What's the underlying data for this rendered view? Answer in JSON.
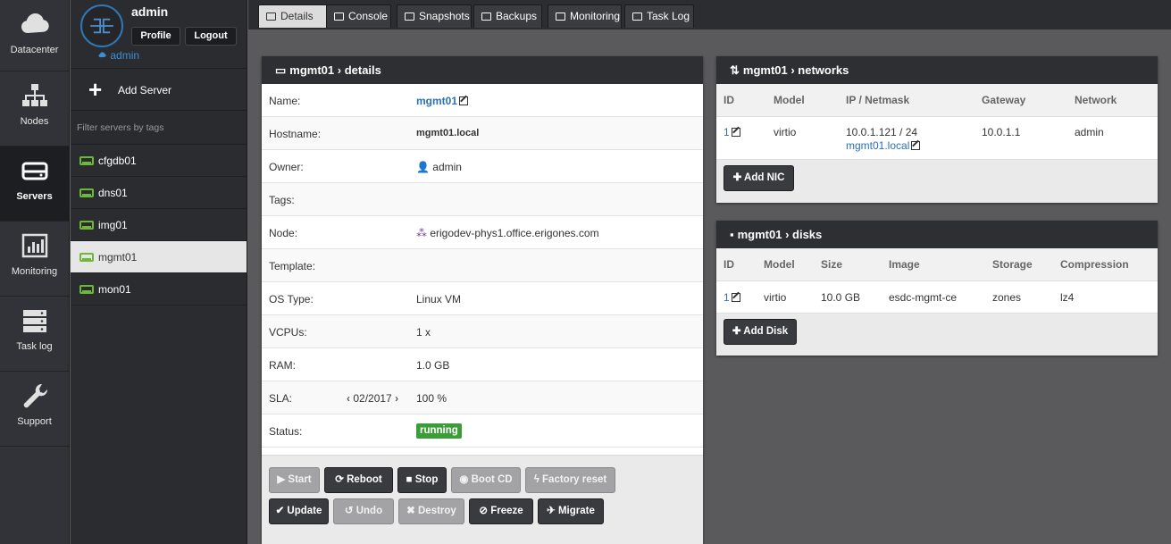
{
  "nav": {
    "items": [
      {
        "label": "Datacenter",
        "icon": "cloud-icon"
      },
      {
        "label": "Nodes",
        "icon": "nodes-icon"
      },
      {
        "label": "Servers",
        "icon": "server-icon"
      },
      {
        "label": "Monitoring",
        "icon": "monitoring-icon"
      },
      {
        "label": "Task log",
        "icon": "tasklog-icon"
      },
      {
        "label": "Support",
        "icon": "wrench-icon"
      }
    ],
    "active": "Servers"
  },
  "sidebar": {
    "username": "admin",
    "profile_label": "Profile",
    "logout_label": "Logout",
    "datacenter": "admin",
    "add_server_label": "Add Server",
    "filter_placeholder": "Filter servers by tags",
    "servers": [
      {
        "name": "cfgdb01"
      },
      {
        "name": "dns01"
      },
      {
        "name": "img01"
      },
      {
        "name": "mgmt01"
      },
      {
        "name": "mon01"
      }
    ],
    "active_server": "mgmt01"
  },
  "tabs": [
    {
      "label": "Details"
    },
    {
      "label": "Console"
    },
    {
      "label": "Snapshots"
    },
    {
      "label": "Backups"
    },
    {
      "label": "Monitoring"
    },
    {
      "label": "Task Log"
    }
  ],
  "details": {
    "title": "mgmt01 › details",
    "rows": [
      {
        "key": "Name:",
        "value": "mgmt01"
      },
      {
        "key": "Hostname:",
        "value": "mgmt01.local"
      },
      {
        "key": "Owner:",
        "value": "admin"
      },
      {
        "key": "Tags:",
        "value": ""
      },
      {
        "key": "Node:",
        "value": "erigodev-phys1.office.erigones.com"
      },
      {
        "key": "Template:",
        "value": ""
      },
      {
        "key": "OS Type:",
        "value": "Linux VM"
      },
      {
        "key": "VCPUs:",
        "value": "1 x"
      },
      {
        "key": "RAM:",
        "value": "1.0 GB"
      },
      {
        "key": "SLA:",
        "value": "100 %"
      },
      {
        "key": "Status:",
        "value": "running"
      }
    ],
    "sla_period": "02/2017",
    "actions_row1": [
      "Start",
      "Reboot",
      "Stop",
      "Boot CD",
      "Factory reset"
    ],
    "actions_row2": [
      "Update",
      "Undo",
      "Destroy",
      "Freeze",
      "Migrate"
    ]
  },
  "networks": {
    "title": "mgmt01 › networks",
    "columns": [
      "ID",
      "Model",
      "IP / Netmask",
      "Gateway",
      "Network"
    ],
    "rows": [
      {
        "id": "1",
        "model": "virtio",
        "ip": "10.0.1.121 / 24",
        "dns": "mgmt01.local",
        "gateway": "10.0.1.1",
        "network": "admin"
      }
    ],
    "add_label": "Add NIC"
  },
  "disks": {
    "title": "mgmt01 › disks",
    "columns": [
      "ID",
      "Model",
      "Size",
      "Image",
      "Storage",
      "Compression"
    ],
    "rows": [
      {
        "id": "1",
        "model": "virtio",
        "size": "10.0 GB",
        "image": "esdc-mgmt-ce",
        "storage": "zones",
        "compression": "lz4"
      }
    ],
    "add_label": "Add Disk"
  },
  "colors": {
    "accent": "#2a72b5",
    "status_running": "#3d9c3a",
    "server_icon": "#6bb935"
  }
}
